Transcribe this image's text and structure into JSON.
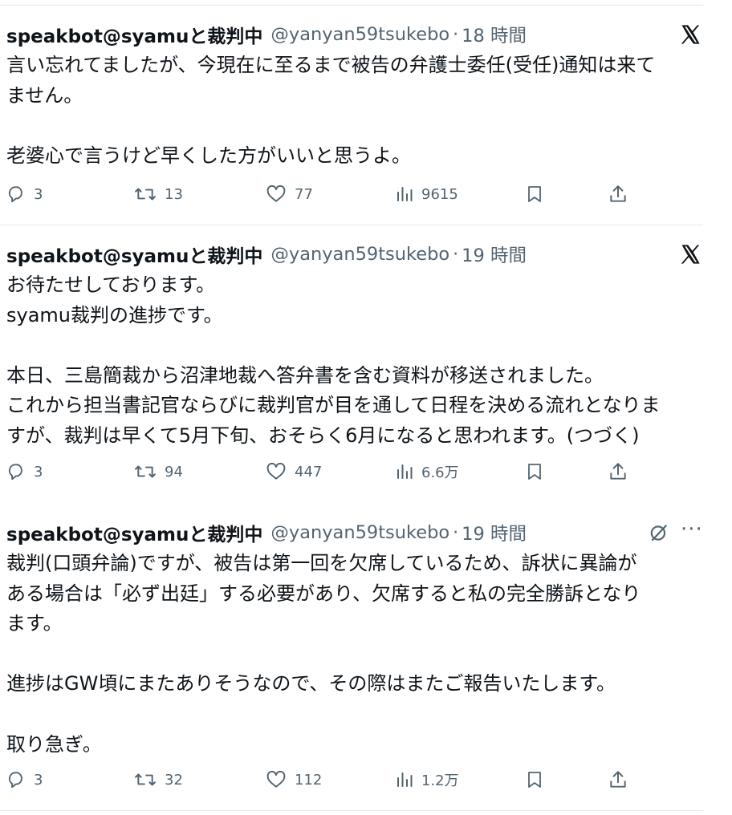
{
  "tweets": [
    {
      "display_name": "speakbot@syamuと裁判中",
      "handle": "@yanyan59tsukebo",
      "separator": "·",
      "time": "18 時間",
      "header_icon": "x-logo-icon",
      "lines": [
        "言い忘れてましたが、今現在に至るまで被告の弁護士委任(受任)通知は来て",
        "ません。",
        "",
        "老婆心で言うけど早くした方がいいと思うよ。"
      ],
      "replies": "3",
      "reposts": "13",
      "likes": "77",
      "views": "9615"
    },
    {
      "display_name": "speakbot@syamuと裁判中",
      "handle": "@yanyan59tsukebo",
      "separator": "·",
      "time": "19 時間",
      "header_icon": "x-logo-icon",
      "lines": [
        "お待たせしております。",
        "syamu裁判の進捗です。",
        "",
        "本日、三島簡裁から沼津地裁へ答弁書を含む資料が移送されました。",
        "これから担当書記官ならびに裁判官が目を通して日程を決める流れとなりま",
        "すが、裁判は早くて5月下旬、おそらく6月になると思われます。(つづく)"
      ],
      "replies": "3",
      "reposts": "94",
      "likes": "447",
      "views": "6.6万"
    },
    {
      "display_name": "speakbot@syamuと裁判中",
      "handle": "@yanyan59tsukebo",
      "separator": "·",
      "time": "19 時間",
      "header_icon": "grok-icon",
      "more_label": "···",
      "lines": [
        "裁判(口頭弁論)ですが、被告は第一回を欠席しているため、訴状に異論が",
        "ある場合は「必ず出廷」する必要があり、欠席すると私の完全勝訴となり",
        "ます。",
        "",
        "進捗はGW頃にまたありそうなので、その際はまたご報告いたします。",
        "",
        "取り急ぎ。"
      ],
      "replies": "3",
      "reposts": "32",
      "likes": "112",
      "views": "1.2万"
    }
  ],
  "icons": {
    "reply": "reply-icon",
    "repost": "repost-icon",
    "like": "heart-icon",
    "views": "views-icon",
    "bookmark": "bookmark-icon",
    "share": "share-icon"
  },
  "colors": {
    "text": "#0f1419",
    "secondary": "#536471",
    "divider": "#e6e8ea"
  }
}
